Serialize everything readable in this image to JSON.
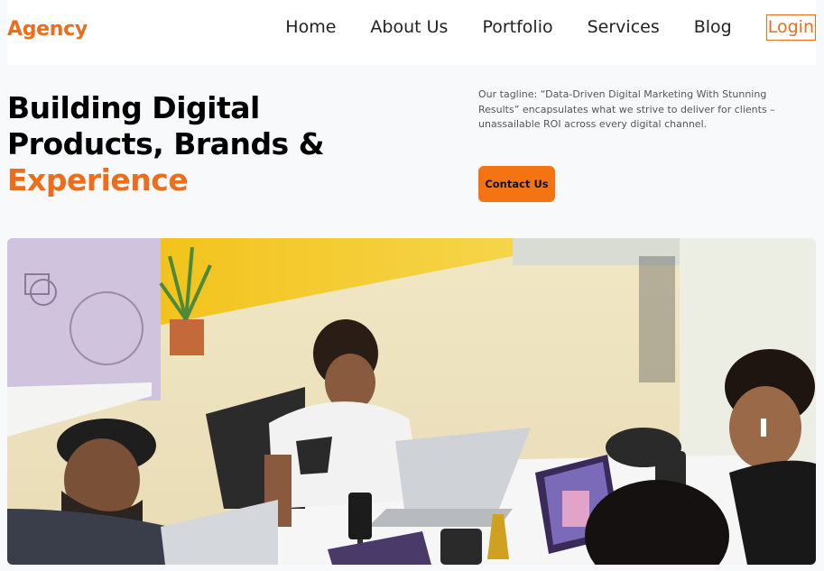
{
  "header": {
    "brand": "Agency",
    "nav": [
      "Home",
      "About Us",
      "Portfolio",
      "Services",
      "Blog"
    ],
    "login": "Login"
  },
  "hero": {
    "title_line1": "Building Digital",
    "title_line2": "Products, Brands &",
    "title_accent": "Experience",
    "tagline": "Our tagline: “Data-Driven Digital Marketing With Stunning Results” encapsulates what we strive to deliver for clients – unassailable ROI across every digital channel.",
    "contact_label": "Contact Us"
  },
  "colors": {
    "accent": "#ed6d1a",
    "button": "#f47414",
    "background": "#f8f9fb"
  }
}
